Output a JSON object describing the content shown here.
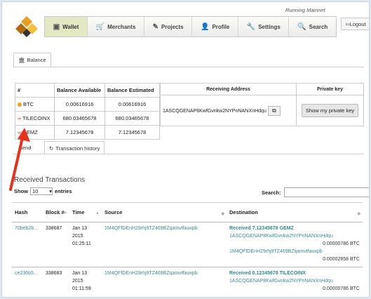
{
  "header": {
    "running_label": "Running Mainnet",
    "logout_label": "Logout"
  },
  "nav": {
    "items": [
      {
        "label": "Wallet",
        "icon": "wallet-icon",
        "active": true
      },
      {
        "label": "Merchants",
        "icon": "cart-icon"
      },
      {
        "label": "Projects",
        "icon": "edit-icon"
      },
      {
        "label": "Profile",
        "icon": "user-icon"
      },
      {
        "label": "Settings",
        "icon": "wrench-icon"
      },
      {
        "label": "Search",
        "icon": "search-icon"
      }
    ]
  },
  "balance_tab": {
    "label": "Balance"
  },
  "balance_table": {
    "headers": [
      "#",
      "Balance Available",
      "Balance Estimated"
    ],
    "rows": [
      {
        "coin": "BTC",
        "available": "0.00616916",
        "estimated": "0.00616916",
        "color": "#f0a020"
      },
      {
        "coin": "TILECOINX",
        "available": "680.03465678",
        "estimated": "680.03465678",
        "color": "#d03030"
      },
      {
        "coin": "GEMZ",
        "available": "7.12345678",
        "estimated": "7.12345678",
        "color": "#d03030"
      }
    ]
  },
  "address_table": {
    "receiving_header": "Receiving Address",
    "private_header": "Private key",
    "address": "1ASCQGENAP8KwfGvnkw2NYPnNAhiXnHdqu",
    "private_button": "Show my private key"
  },
  "subtabs": {
    "send": "Send",
    "history": "Transaction history"
  },
  "transactions": {
    "title": "Received Transactions",
    "show_label": "Show",
    "show_value": "10",
    "entries_label": "entries",
    "search_label": "Search:",
    "headers": {
      "hash": "Hash",
      "block": "Block #",
      "time": "Time",
      "source": "Source",
      "destination": "Destination"
    },
    "rows": [
      {
        "hash": "70beb2b...",
        "block": "338687",
        "time": [
          "Jan 13",
          "2015",
          "01:25:11"
        ],
        "source": "1M4QFfDEnH29rhj9TZ469BZqamvtfauxpb",
        "dest_title": "Received 7.12345678 GEMZ",
        "lines": [
          {
            "addr": "1ASCQGENAP8KwfGvnkw2NYPnNAhiXnHdqu",
            "amt": "0.00000786 BTC"
          },
          {
            "addr": "1M4QFfDEnH29rhj9TZ469BZqamvtfauxpb",
            "amt": "0.00002858 BTC"
          }
        ]
      },
      {
        "hash": "ce236b5...",
        "block": "338683",
        "time": [
          "Jan 13",
          "2015",
          "01:11:59"
        ],
        "source": "1M4QFfDEnH29rhj9TZ469BZqamvtfauxpb",
        "dest_title": "Received 0.12345678 TILECOINX",
        "lines": [
          {
            "addr": "1ASCQGENAP8KwfGvnkw2NYPnNAhiXnHdqu",
            "amt": "0.00000786 BTC"
          }
        ]
      }
    ]
  }
}
